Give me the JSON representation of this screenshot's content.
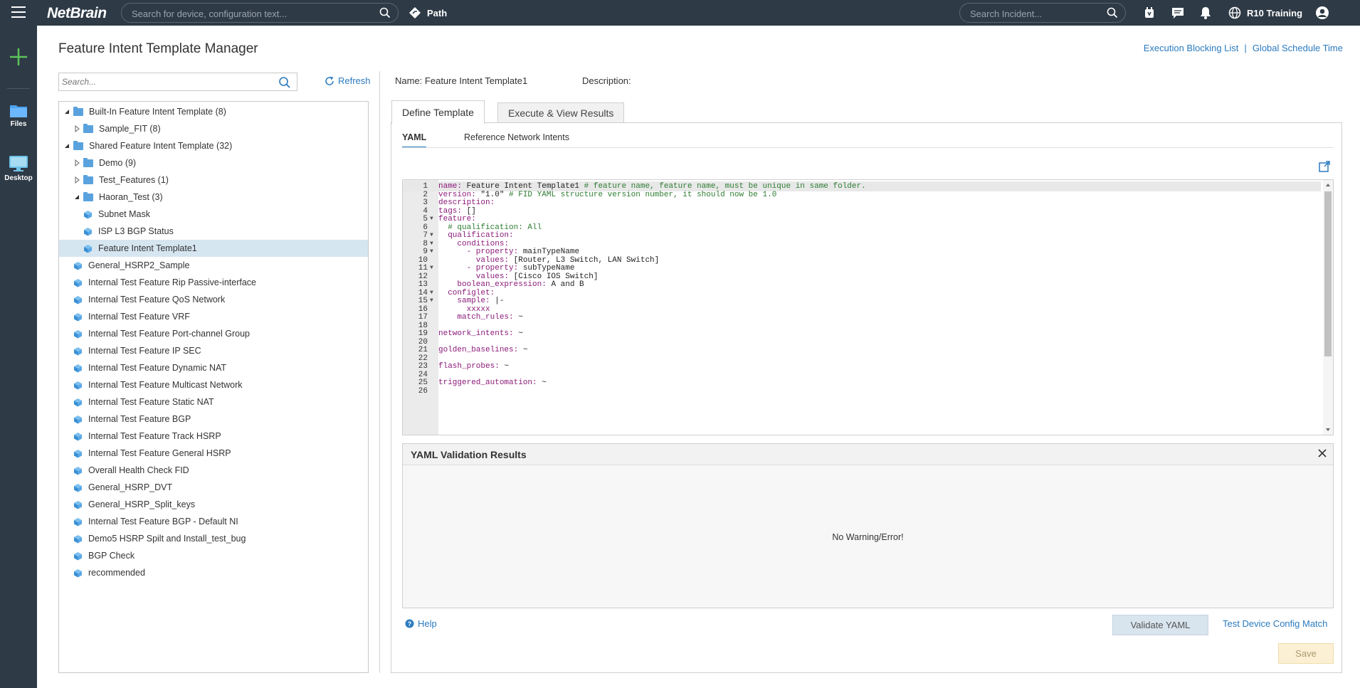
{
  "topbar": {
    "logo": "NetBrain",
    "search_placeholder": "Search for device, configuration text...",
    "path_label": "Path",
    "incident_placeholder": "Search Incident...",
    "user_label": "R10 Training"
  },
  "rail": {
    "files_label": "Files",
    "desktop_label": "Desktop"
  },
  "page": {
    "title": "Feature Intent Template Manager",
    "links": [
      "Execution Blocking List",
      "|",
      "Global Schedule Time"
    ]
  },
  "left": {
    "search_placeholder": "Search...",
    "refresh_label": "Refresh",
    "tree": [
      {
        "label": "Built-In Feature Intent Template (8)",
        "level": 0,
        "type": "folder",
        "expander": "open"
      },
      {
        "label": "Sample_FIT (8)",
        "level": 1,
        "type": "folder",
        "expander": "closed"
      },
      {
        "label": "Shared Feature Intent Template (32)",
        "level": 0,
        "type": "folder",
        "expander": "open"
      },
      {
        "label": "Demo (9)",
        "level": 1,
        "type": "folder",
        "expander": "closed"
      },
      {
        "label": "Test_Features (1)",
        "level": 1,
        "type": "folder",
        "expander": "closed"
      },
      {
        "label": "Haoran_Test (3)",
        "level": 1,
        "type": "folder",
        "expander": "open"
      },
      {
        "label": "Subnet Mask",
        "level": 2,
        "type": "item"
      },
      {
        "label": "ISP L3 BGP Status",
        "level": 2,
        "type": "item"
      },
      {
        "label": "Feature Intent Template1",
        "level": 2,
        "type": "item",
        "selected": true
      },
      {
        "label": "General_HSRP2_Sample",
        "level": 1,
        "type": "item"
      },
      {
        "label": "Internal Test Feature Rip Passive-interface",
        "level": 1,
        "type": "item"
      },
      {
        "label": "Internal Test Feature QoS Network",
        "level": 1,
        "type": "item"
      },
      {
        "label": "Internal Test Feature VRF",
        "level": 1,
        "type": "item"
      },
      {
        "label": "Internal Test Feature Port-channel Group",
        "level": 1,
        "type": "item"
      },
      {
        "label": "Internal Test Feature IP SEC",
        "level": 1,
        "type": "item"
      },
      {
        "label": "Internal Test Feature Dynamic NAT",
        "level": 1,
        "type": "item"
      },
      {
        "label": "Internal Test Feature Multicast Network",
        "level": 1,
        "type": "item"
      },
      {
        "label": "Internal Test Feature Static NAT",
        "level": 1,
        "type": "item"
      },
      {
        "label": "Internal Test Feature BGP",
        "level": 1,
        "type": "item"
      },
      {
        "label": "Internal Test Feature Track HSRP",
        "level": 1,
        "type": "item"
      },
      {
        "label": "Internal Test Feature General HSRP",
        "level": 1,
        "type": "item"
      },
      {
        "label": "Overall Health Check FID",
        "level": 1,
        "type": "item"
      },
      {
        "label": "General_HSRP_DVT",
        "level": 1,
        "type": "item"
      },
      {
        "label": "General_HSRP_Split_keys",
        "level": 1,
        "type": "item"
      },
      {
        "label": "Internal Test Feature BGP - Default NI",
        "level": 1,
        "type": "item"
      },
      {
        "label": "Demo5 HSRP Spilt and Install_test_bug",
        "level": 1,
        "type": "item"
      },
      {
        "label": "BGP Check",
        "level": 1,
        "type": "item"
      },
      {
        "label": "recommended",
        "level": 1,
        "type": "item"
      }
    ]
  },
  "right": {
    "name_label": "Name:",
    "name_value": "Feature Intent Template1",
    "description_label": "Description:",
    "tabs": [
      "Define Template",
      "Execute & View Results"
    ],
    "subtabs": [
      "YAML",
      "Reference Network Intents"
    ],
    "code_lines": [
      {
        "n": "1",
        "fold": "",
        "parts": [
          [
            "k",
            "name: "
          ],
          [
            "",
            "Feature Intent Template1 "
          ],
          [
            "cm",
            "# feature name, feature name, must be unique in same folder."
          ]
        ]
      },
      {
        "n": "2",
        "fold": "",
        "parts": [
          [
            "k",
            "version: "
          ],
          [
            "",
            "\"1.0\" "
          ],
          [
            "cm",
            "# FID YAML structure version number, it should now be 1.0"
          ]
        ]
      },
      {
        "n": "3",
        "fold": "",
        "parts": [
          [
            "k",
            "description:"
          ]
        ]
      },
      {
        "n": "4",
        "fold": "",
        "parts": [
          [
            "k",
            "tags: "
          ],
          [
            "",
            "[]"
          ]
        ]
      },
      {
        "n": "5",
        "fold": "▼",
        "parts": [
          [
            "k",
            "feature:"
          ]
        ]
      },
      {
        "n": "6",
        "fold": "",
        "parts": [
          [
            "",
            "  "
          ],
          [
            "cm",
            "# qualification: All"
          ]
        ]
      },
      {
        "n": "7",
        "fold": "▼",
        "parts": [
          [
            "k",
            "  qualification:"
          ]
        ]
      },
      {
        "n": "8",
        "fold": "▼",
        "parts": [
          [
            "k",
            "    conditions:"
          ]
        ]
      },
      {
        "n": "9",
        "fold": "▼",
        "parts": [
          [
            "k",
            "      - property: "
          ],
          [
            "",
            "mainTypeName"
          ]
        ]
      },
      {
        "n": "10",
        "fold": "",
        "parts": [
          [
            "k",
            "        values: "
          ],
          [
            "",
            "[Router, L3 Switch, LAN Switch]"
          ]
        ]
      },
      {
        "n": "11",
        "fold": "▼",
        "parts": [
          [
            "k",
            "      - property: "
          ],
          [
            "",
            "subTypeName"
          ]
        ]
      },
      {
        "n": "12",
        "fold": "",
        "parts": [
          [
            "k",
            "        values: "
          ],
          [
            "",
            "[Cisco IOS Switch]"
          ]
        ]
      },
      {
        "n": "13",
        "fold": "",
        "parts": [
          [
            "k",
            "    boolean_expression: "
          ],
          [
            "",
            "A and B"
          ]
        ]
      },
      {
        "n": "14",
        "fold": "▼",
        "parts": [
          [
            "k",
            "  configlet:"
          ]
        ]
      },
      {
        "n": "15",
        "fold": "▼",
        "parts": [
          [
            "k",
            "    sample: "
          ],
          [
            "",
            "|-"
          ]
        ]
      },
      {
        "n": "16",
        "fold": "",
        "parts": [
          [
            "k",
            "      xxxxx"
          ]
        ]
      },
      {
        "n": "17",
        "fold": "",
        "parts": [
          [
            "k",
            "    match_rules: "
          ],
          [
            "",
            "~"
          ]
        ]
      },
      {
        "n": "18",
        "fold": "",
        "parts": []
      },
      {
        "n": "19",
        "fold": "",
        "parts": [
          [
            "k",
            "network_intents: "
          ],
          [
            "",
            "~"
          ]
        ]
      },
      {
        "n": "20",
        "fold": "",
        "parts": []
      },
      {
        "n": "21",
        "fold": "",
        "parts": [
          [
            "k",
            "golden_baselines: "
          ],
          [
            "",
            "~"
          ]
        ]
      },
      {
        "n": "22",
        "fold": "",
        "parts": []
      },
      {
        "n": "23",
        "fold": "",
        "parts": [
          [
            "k",
            "flash_probes: "
          ],
          [
            "",
            "~"
          ]
        ]
      },
      {
        "n": "24",
        "fold": "",
        "parts": []
      },
      {
        "n": "25",
        "fold": "",
        "parts": [
          [
            "k",
            "triggered_automation: "
          ],
          [
            "",
            "~"
          ]
        ]
      },
      {
        "n": "26",
        "fold": "",
        "parts": []
      }
    ],
    "validation_title": "YAML Validation Results",
    "validation_message": "No Warning/Error!",
    "help_label": "Help",
    "validate_label": "Validate YAML",
    "test_link": "Test Device Config Match",
    "save_label": "Save"
  },
  "colors": {
    "topbar": "#2e3a46",
    "accent": "#2b7bbf",
    "selected_row": "#d6e6f1",
    "folder": "#5aa2dd"
  }
}
